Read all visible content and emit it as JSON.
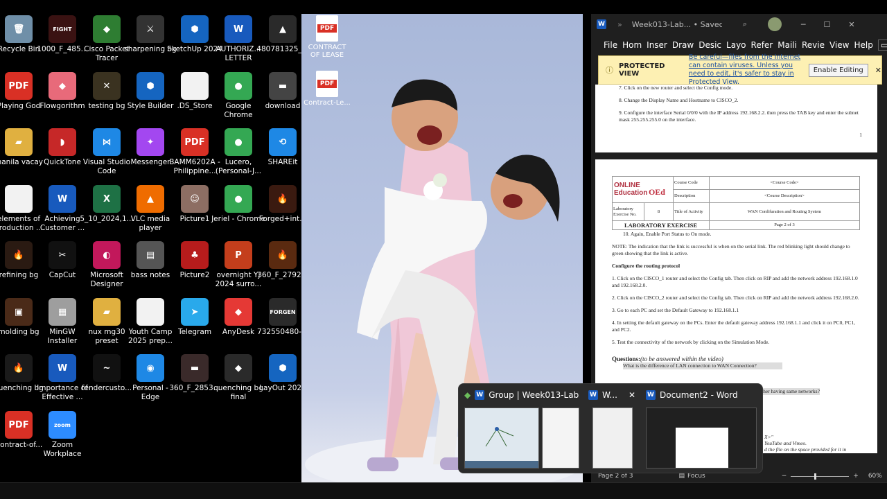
{
  "desktop_icons": [
    {
      "label": "Recycle Bin",
      "glyph": "🗑",
      "color": "#6f8fa8"
    },
    {
      "label": "1000_F_485...",
      "glyph": "FIGHT",
      "color": "#3a1212"
    },
    {
      "label": "Cisco Packet Tracer",
      "glyph": "◆",
      "color": "#2e7d32"
    },
    {
      "label": "sharpening bg",
      "glyph": "⚔",
      "color": "#333333"
    },
    {
      "label": "SketchUp 2024",
      "glyph": "⬢",
      "color": "#1565c0"
    },
    {
      "label": "AUTHORIZ... LETTER",
      "glyph": "W",
      "color": "#185abd"
    },
    {
      "label": "480781325_...",
      "glyph": "▲",
      "color": "#2a2a2a"
    },
    {
      "label": "Playing God",
      "glyph": "PDF",
      "color": "#d93025"
    },
    {
      "label": "Flowgorithm",
      "glyph": "◆",
      "color": "#e86a7a"
    },
    {
      "label": "testing bg",
      "glyph": "✕",
      "color": "#3a3220"
    },
    {
      "label": "Style Builder",
      "glyph": "⬢",
      "color": "#1565c0"
    },
    {
      "label": ".DS_Store",
      "glyph": "",
      "color": "#f2f2f2"
    },
    {
      "label": "Google Chrome",
      "glyph": "●",
      "color": "#34a853"
    },
    {
      "label": "download",
      "glyph": "▬",
      "color": "#444444"
    },
    {
      "label": "manila vacay",
      "glyph": "▰",
      "color": "#e0b040"
    },
    {
      "label": "QuickTone",
      "glyph": "◗",
      "color": "#c62828"
    },
    {
      "label": "Visual Studio Code",
      "glyph": "⋈",
      "color": "#1e88e5"
    },
    {
      "label": "Messenger",
      "glyph": "✦",
      "color": "#a347f0"
    },
    {
      "label": "BAMM6202A - Philippine...",
      "glyph": "PDF",
      "color": "#d93025"
    },
    {
      "label": "Lucero, (Personal-J...",
      "glyph": "●",
      "color": "#34a853"
    },
    {
      "label": "SHAREit",
      "glyph": "⟲",
      "color": "#1e88e5"
    },
    {
      "label": "elements of production ...",
      "glyph": "",
      "color": "#f2f2f2"
    },
    {
      "label": "Achieving Customer ...",
      "glyph": "W",
      "color": "#185abd"
    },
    {
      "label": "5_10_2024,1...",
      "glyph": "X",
      "color": "#1e7145"
    },
    {
      "label": "VLC media player",
      "glyph": "▲",
      "color": "#ef6c00"
    },
    {
      "label": "Picture1",
      "glyph": "☺",
      "color": "#8d6e63"
    },
    {
      "label": "Jeriel - Chrome",
      "glyph": "●",
      "color": "#34a853"
    },
    {
      "label": "Forged+int...",
      "glyph": "🔥",
      "color": "#3a1a10"
    },
    {
      "label": "refining bg",
      "glyph": "🔥",
      "color": "#2a1a12"
    },
    {
      "label": "CapCut",
      "glyph": "✂",
      "color": "#111111"
    },
    {
      "label": "Microsoft Designer",
      "glyph": "◐",
      "color": "#c2185b"
    },
    {
      "label": "bass notes",
      "glyph": "▤",
      "color": "#555555"
    },
    {
      "label": "Picture2",
      "glyph": "♣",
      "color": "#b71c1c"
    },
    {
      "label": "overnight YJ 2024 surro...",
      "glyph": "P",
      "color": "#c43e1c"
    },
    {
      "label": "360_F_2792...",
      "glyph": "🔥",
      "color": "#5a2a10"
    },
    {
      "label": "molding bg",
      "glyph": "▣",
      "color": "#4a2a18"
    },
    {
      "label": "MinGW Installer",
      "glyph": "▦",
      "color": "#9e9e9e"
    },
    {
      "label": "nux mg30 preset",
      "glyph": "▰",
      "color": "#e0b040"
    },
    {
      "label": "Youth Camp 2025 prep...",
      "glyph": "",
      "color": "#f2f2f2"
    },
    {
      "label": "Telegram",
      "glyph": "➤",
      "color": "#29a9eb"
    },
    {
      "label": "AnyDesk",
      "glyph": "◆",
      "color": "#e53935"
    },
    {
      "label": "732550480-...",
      "glyph": "FORGEN",
      "color": "#2a2a2a"
    },
    {
      "label": "quenching bg",
      "glyph": "🔥",
      "color": "#1a1a1a"
    },
    {
      "label": "Importance of Effective ...",
      "glyph": "W",
      "color": "#185abd"
    },
    {
      "label": "fendercusto...",
      "glyph": "~",
      "color": "#111111"
    },
    {
      "label": "Personal - Edge",
      "glyph": "◉",
      "color": "#1e88e5"
    },
    {
      "label": "360_F_2853...",
      "glyph": "▬",
      "color": "#3a2a2a"
    },
    {
      "label": "quenching bg final",
      "glyph": "◆",
      "color": "#2a2a2a"
    },
    {
      "label": "LayOut 2024",
      "glyph": "⬢",
      "color": "#1565c0"
    },
    {
      "label": "Contract-of...",
      "glyph": "PDF",
      "color": "#d93025"
    },
    {
      "label": "Zoom Workplace",
      "glyph": "zoom",
      "color": "#2d8cff"
    }
  ],
  "photo_icons": [
    {
      "label": "CONTRACT OF LEASE"
    },
    {
      "label": "Contract-Le..."
    }
  ],
  "word": {
    "icon": "W",
    "overflow": "»",
    "title": "Week013-Lab... • Saved ∨",
    "menu": [
      "File",
      "Hom",
      "Inser",
      "Draw",
      "Desic",
      "Layo",
      "Refer",
      "Maili",
      "Revie",
      "View",
      "Help"
    ],
    "protected_label": "PROTECTED VIEW",
    "protected_message": "Be careful—files from the Internet can contain viruses. Unless you need to edit, it's safer to stay in Protected View.",
    "enable_editing": "Enable Editing",
    "page1_lines": [
      "7.   Click on the new router and select the Config mode.",
      "8.   Change the Display Name and Hostname to CISCO_2.",
      "9.   Configure the interface Serial 0/0/0 with the IP address 192.168.2.2. then press the TAB key and enter the subnet mask 255.255.255.0 on the interface."
    ],
    "page1_number": "1",
    "header": {
      "logo": "ONLINE Education",
      "logo_tag": "OEd",
      "course_code_label": "Course Code",
      "course_code_value": "<Course Code>",
      "description_label": "Description",
      "description_value": "<Course Description>",
      "lab_label": "Laboratory Exercise No.",
      "lab_value": "8",
      "title_label": "Title of Activity",
      "title_value": "WAN Confifuration and Routing System",
      "banner": "LABORATORY EXERCISE",
      "page_of": "Page 2 of 3"
    },
    "page2_lines": [
      "10. Again, Enable Port Status to On mode.",
      "NOTE: The indication that the link is successful is when on the serial link. The red blinking light should change to green showing that the link is active.",
      "Configure the routing protocol",
      "1. Click on the CISCO_1 router and select the Config tab. Then click on RIP and add the network address 192.168.1.0 and 192.168.2.0.",
      "2.  Click on the CISCO_2 router and select the Config tab. Then click on RIP and add the network address 192.168.2.0.",
      "3. Go to each PC and set the Default Gateway to 192.168.1.1",
      "4. In setting the default gateway on the PCs. Enter the default gateway address 192.168.1.1 and click it on PC0, PC1, and PC2.",
      "5. Test the connectivity of the network by clicking on the Simulation Mode."
    ],
    "questions_label": "Questions:",
    "questions_hint": "(to be answered within the video)",
    "partial_lines": [
      "What is the difference of LAN connection to WAN Connection?",
      "ther having same networks?",
      "X>\"",
      "YouTube and Vimeo.",
      "d the file on the space provided for it in"
    ],
    "status_page": "Page 2 of 3",
    "status_focus": "Focus",
    "zoom": "60%"
  },
  "taskbar_flyout": {
    "groups": [
      {
        "label": "Group | Week013-Labo..."
      },
      {
        "label": "W..."
      },
      {
        "label": "Document2 - Word"
      }
    ]
  }
}
